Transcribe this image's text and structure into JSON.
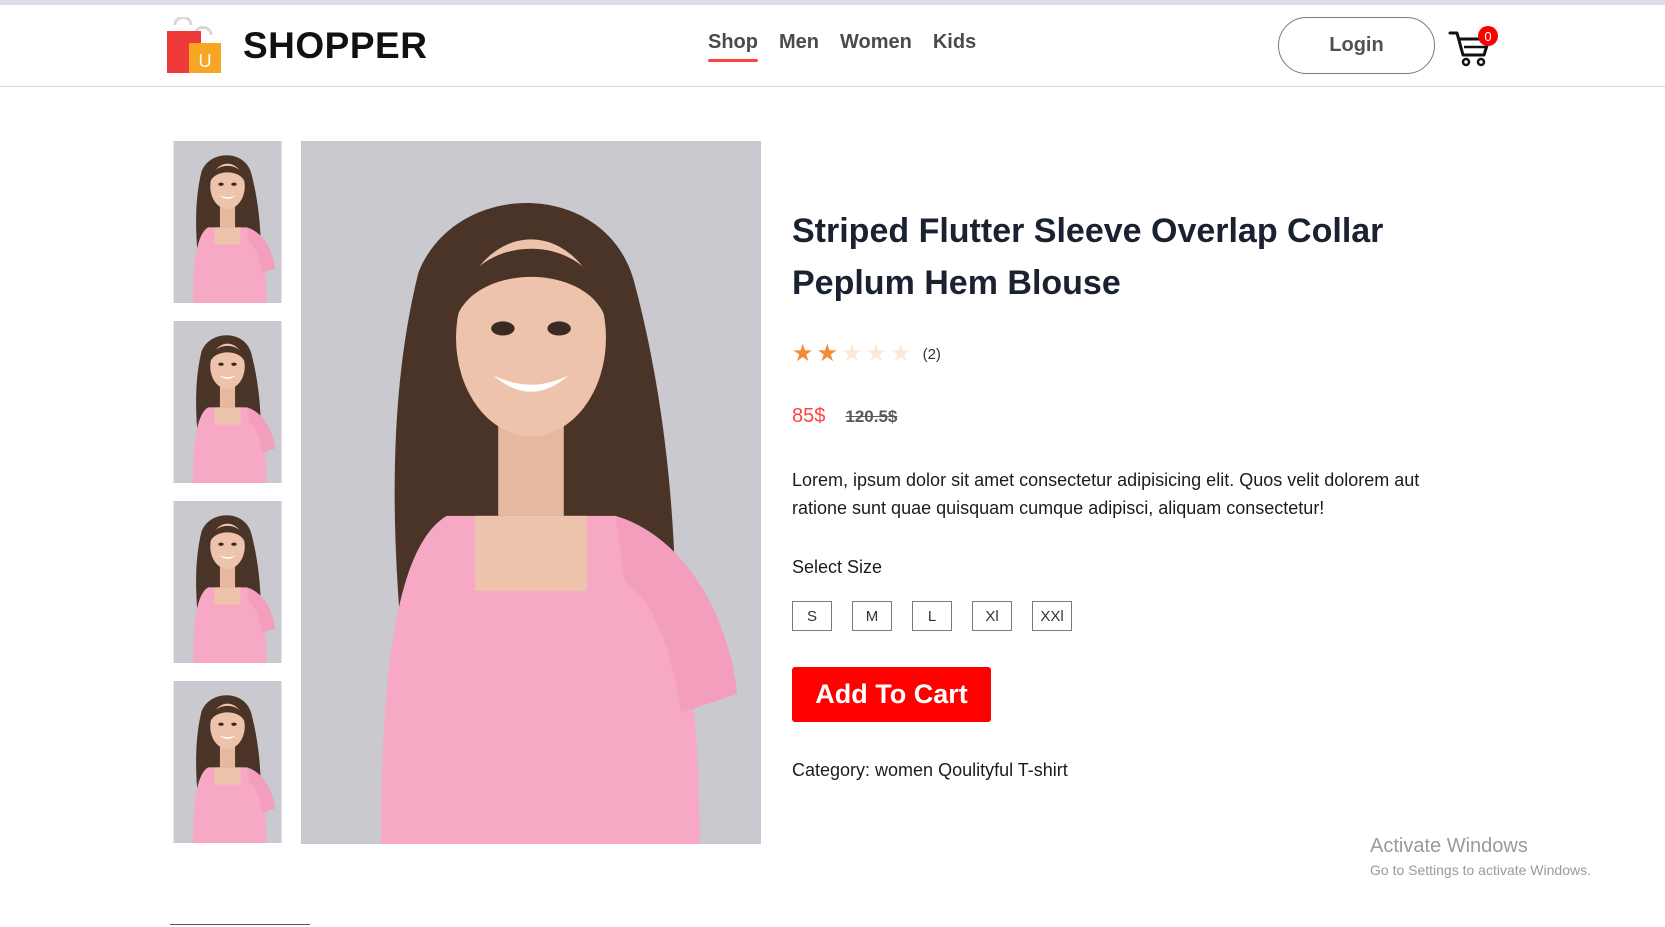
{
  "brand": {
    "name": "SHOPPER",
    "logo_letter": "U",
    "logo_icon": "shopping-bag-icon"
  },
  "nav": {
    "items": [
      {
        "label": "Shop",
        "active": true
      },
      {
        "label": "Men",
        "active": false
      },
      {
        "label": "Women",
        "active": false
      },
      {
        "label": "Kids",
        "active": false
      }
    ]
  },
  "header": {
    "login_label": "Login",
    "cart_icon": "cart-icon",
    "cart_count": "0"
  },
  "gallery": {
    "thumbnail_count": 4,
    "image_subject": "woman in pink square-neck t-shirt"
  },
  "product": {
    "title": "Striped Flutter Sleeve Overlap Collar Peplum Hem Blouse",
    "rating": {
      "stars_filled": 2,
      "stars_total": 5,
      "review_count": "(2)"
    },
    "price_new": "85$",
    "price_old": "120.5$",
    "description": "Lorem, ipsum dolor sit amet consectetur adipisicing elit. Quos velit dolorem aut ratione sunt quae quisquam cumque adipisci, aliquam consectetur!",
    "size_label": "Select Size",
    "sizes": [
      "S",
      "M",
      "L",
      "Xl",
      "XXl"
    ],
    "add_to_cart_label": "Add To Cart",
    "category": "Category: women Qoulityful T-shirt"
  },
  "watermark": {
    "title": "Activate Windows",
    "subtitle": "Go to Settings to activate Windows."
  },
  "colors": {
    "accent": "#ff4141",
    "button": "#ff0000",
    "star": "#f28c38",
    "shirt": "#f7a8c4"
  }
}
